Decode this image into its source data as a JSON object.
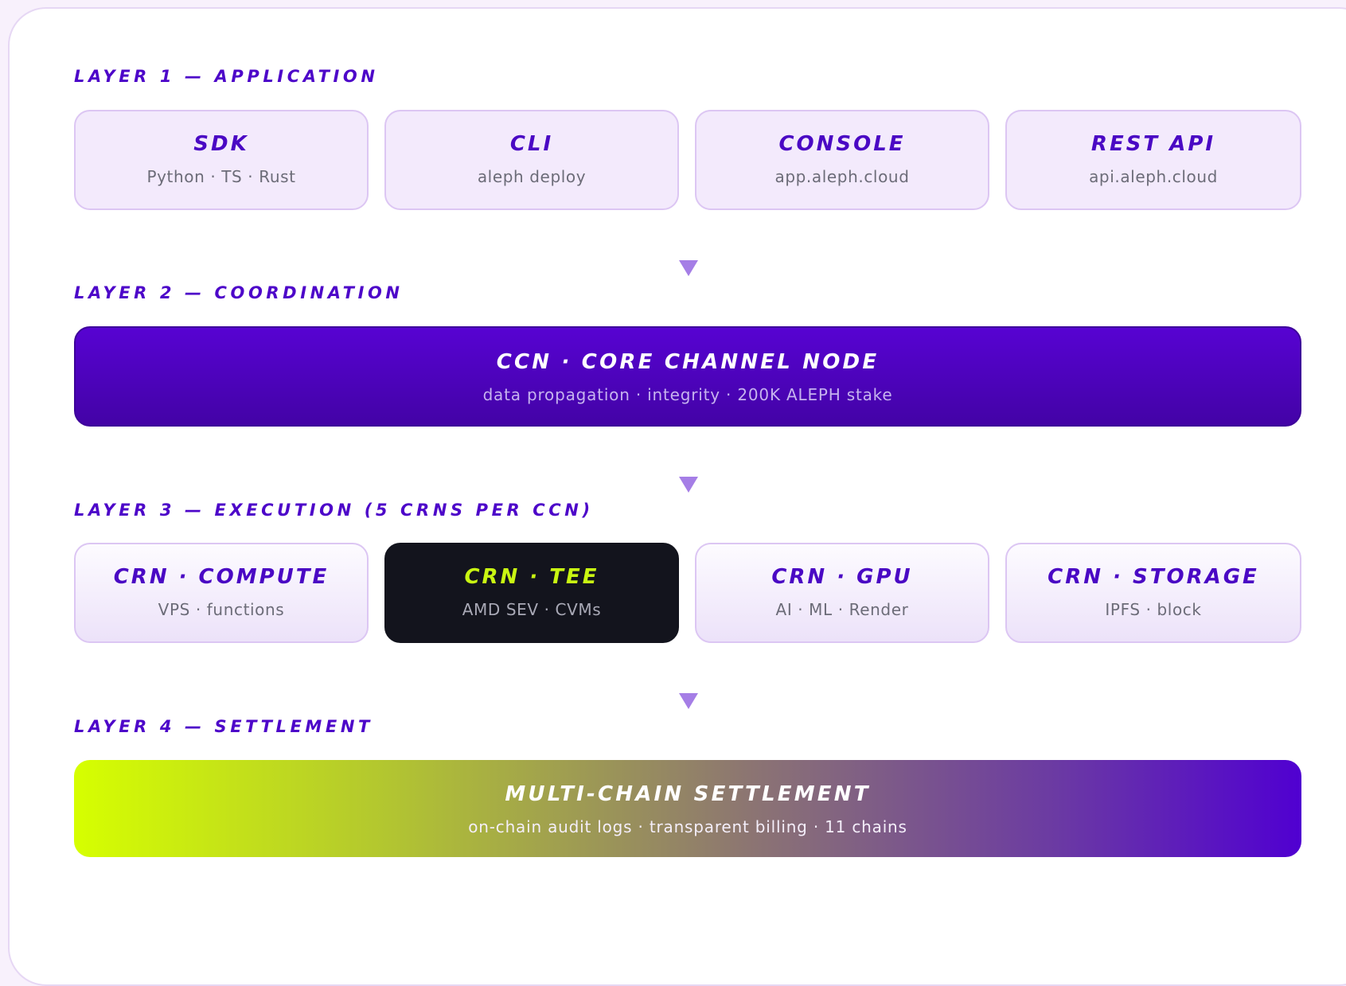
{
  "layers": [
    {
      "label": "LAYER 1 — APPLICATION",
      "boxes": [
        {
          "title": "SDK",
          "subtitle": "Python · TS · Rust"
        },
        {
          "title": "CLI",
          "subtitle": "aleph deploy"
        },
        {
          "title": "CONSOLE",
          "subtitle": "app.aleph.cloud"
        },
        {
          "title": "REST API",
          "subtitle": "api.aleph.cloud"
        }
      ]
    },
    {
      "label": "LAYER 2 — COORDINATION",
      "band": {
        "title": "CCN · CORE CHANNEL NODE",
        "subtitle": "data propagation · integrity · 200K ALEPH stake"
      }
    },
    {
      "label": "LAYER 3 — EXECUTION (5 CRNS PER CCN)",
      "boxes": [
        {
          "title": "CRN · COMPUTE",
          "subtitle": "VPS · functions"
        },
        {
          "title": "CRN · TEE",
          "subtitle": "AMD SEV · CVMs"
        },
        {
          "title": "CRN · GPU",
          "subtitle": "AI · ML · Render"
        },
        {
          "title": "CRN · STORAGE",
          "subtitle": "IPFS · block"
        }
      ]
    },
    {
      "label": "LAYER 4 — SETTLEMENT",
      "band": {
        "title": "MULTI-CHAIN SETTLEMENT",
        "subtitle": "on-chain audit logs · transparent billing · 11 chains"
      }
    }
  ],
  "colors": {
    "accent_purple": "#4d06c9",
    "ccn_band": "#5000d1",
    "tee_box": "#13141d",
    "tee_accent": "#c9f612",
    "settlement_gradient_start": "#d6ff00",
    "settlement_gradient_end": "#5000d1",
    "arrow": "#a57ee6"
  },
  "icons": [
    "arrow-down-icon"
  ]
}
